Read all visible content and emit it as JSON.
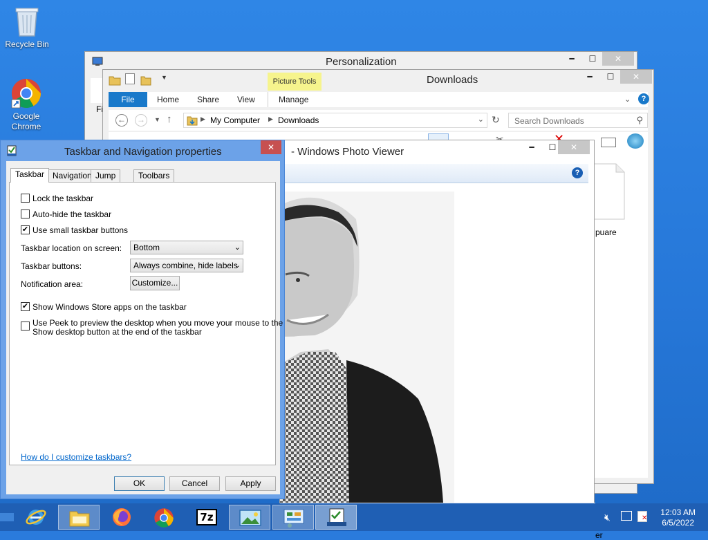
{
  "desktop": {
    "icons": [
      {
        "name": "recycle-bin",
        "label": "Recycle Bin"
      },
      {
        "name": "google-chrome",
        "label": "Google Chrome"
      }
    ]
  },
  "personalization": {
    "title": "Personalization",
    "partial_text": "Fi"
  },
  "explorer": {
    "title": "Downloads",
    "context_tab": "Picture Tools",
    "tabs": {
      "file": "File",
      "home": "Home",
      "share": "Share",
      "view": "View",
      "manage": "Manage"
    },
    "breadcrumb": {
      "root": "My Computer",
      "current": "Downloads"
    },
    "search_placeholder": "Search Downloads",
    "file_label_partial": "puare",
    "status_partial": "er"
  },
  "photo_viewer": {
    "title": "- Windows Photo Viewer"
  },
  "props_dialog": {
    "title": "Taskbar and Navigation properties",
    "tabs": [
      "Taskbar",
      "Navigation",
      "Jump Lists",
      "Toolbars"
    ],
    "checkboxes": {
      "lock": {
        "label": "Lock the taskbar",
        "checked": false
      },
      "autohide": {
        "label": "Auto-hide the taskbar",
        "checked": false
      },
      "small": {
        "label": "Use small taskbar buttons",
        "checked": true
      },
      "store": {
        "label": "Show Windows Store apps on the taskbar",
        "checked": true
      },
      "peek": {
        "label1": "Use Peek to preview the desktop when you move your mouse to the",
        "label2": "Show desktop button at the end of the taskbar",
        "checked": false
      }
    },
    "location_label": "Taskbar location on screen:",
    "location_value": "Bottom",
    "buttons_label": "Taskbar buttons:",
    "buttons_value": "Always combine, hide labels",
    "notification_label": "Notification area:",
    "customize_button": "Customize...",
    "help_link": "How do I customize taskbars?",
    "ok": "OK",
    "cancel": "Cancel",
    "apply": "Apply",
    "check_glyph": "✔"
  },
  "taskbar": {
    "apps": [
      "internet-explorer",
      "file-explorer",
      "firefox",
      "chrome",
      "7zip",
      "photo-viewer",
      "control-panel",
      "taskbar-properties"
    ],
    "sevenzip_label": "7z",
    "time": "12:03 AM",
    "date": "6/5/2022"
  }
}
